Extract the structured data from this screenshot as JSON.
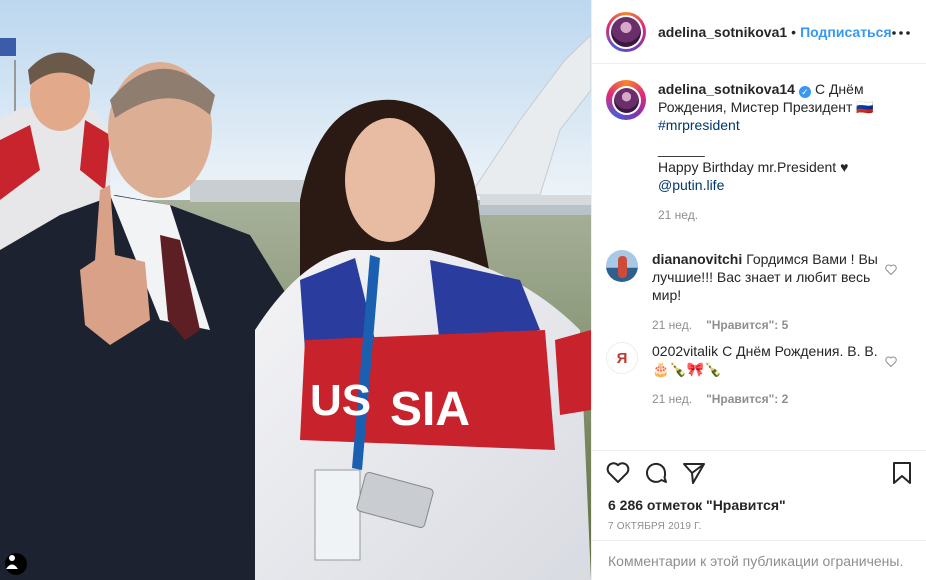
{
  "header": {
    "username": "adelina_sotnikova1",
    "separator": "•",
    "follow_label": "Подписаться",
    "more_icon": "more-horizontal-icon"
  },
  "caption": {
    "username": "adelina_sotnikova14",
    "verified": true,
    "text": "С Днём Рождения, Мистер Президент 🇷🇺",
    "hashtag": "#mrpresident",
    "divider": "______",
    "line2": "Happy Birthday mr.President ♥",
    "mention": "@putin.life",
    "time": "21 нед."
  },
  "comments": [
    {
      "username": "diananovitchi",
      "text": "Гордимся Вами ! Вы лучшие!!! Вас знает и любит весь мир!",
      "time": "21 нед.",
      "likes": "\"Нравится\": 5"
    },
    {
      "username": "0202vitalik",
      "avatar_letter": "Я",
      "text": "С Днём Рождения. В. В. 🎂🍾🎀🍾",
      "time": "21 нед.",
      "likes": "\"Нравится\": 2"
    }
  ],
  "actions": {
    "icons": [
      "heart-icon",
      "comment-icon",
      "share-icon",
      "bookmark-icon"
    ],
    "likes_text": "6 286 отметок \"Нравится\"",
    "date": "7 ОКТЯБРЯ 2019 Г."
  },
  "footer": {
    "restricted_text": "Комментарии к этой публикации ограничены."
  },
  "photo": {
    "jacket_text_left": "US",
    "jacket_text_right": "SIA"
  }
}
